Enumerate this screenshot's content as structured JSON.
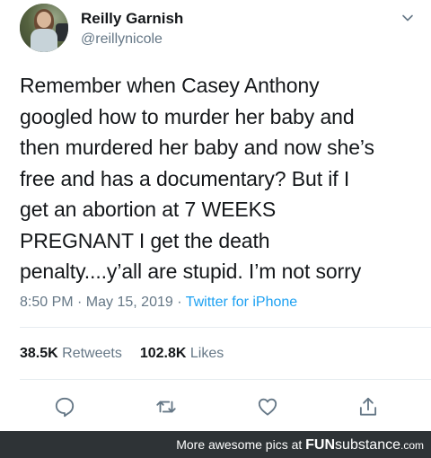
{
  "user": {
    "name": "Reilly Garnish",
    "handle": "@reillynicole"
  },
  "tweet": {
    "lines": [
      "Remember when Casey Anthony",
      "googled how to murder her baby and",
      "then murdered her baby and now she’s",
      "free and has a documentary? But if I",
      "get an abortion at 7 WEEKS",
      "PREGNANT I get the death",
      "penalty....y’all are stupid. I’m not sorry"
    ],
    "time": "8:50 PM · May 15, 2019 · ",
    "source": "Twitter for iPhone"
  },
  "stats": {
    "retweets_count": "38.5K",
    "retweets_label": "Retweets",
    "likes_count": "102.8K",
    "likes_label": "Likes"
  },
  "actions": {
    "icons": [
      "reply-icon",
      "retweet-icon",
      "like-icon",
      "share-icon"
    ]
  },
  "footer": {
    "text": "More awesome pics at ",
    "brand_bold": "FUN",
    "brand_rest": "substance",
    "brand_tld": ".com"
  },
  "colors": {
    "text": "#14171a",
    "muted": "#657786",
    "link": "#1da1f2",
    "footer_bg": "#2e3336"
  }
}
